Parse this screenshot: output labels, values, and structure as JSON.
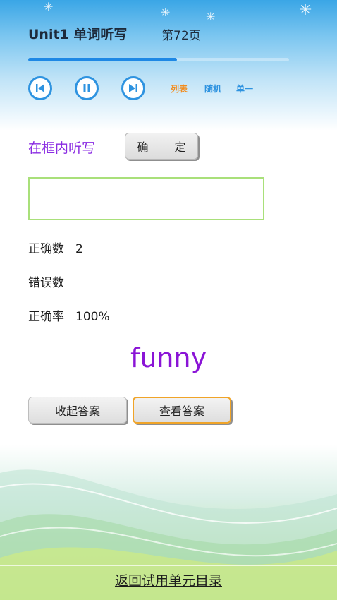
{
  "header": {
    "title": "Unit1 单词听写",
    "page": "第72页",
    "progress_fraction": 0.57
  },
  "controls": {
    "prev_icon": "skip-previous-icon",
    "pause_icon": "pause-icon",
    "next_icon": "skip-next-icon",
    "modes": [
      {
        "label": "列表",
        "color": "#f28c1e"
      },
      {
        "label": "随机",
        "color": "#2e93e0"
      },
      {
        "label": "单一",
        "color": "#2e93e0"
      }
    ]
  },
  "dictation": {
    "prompt": "在框内听写",
    "confirm_label": "确 定",
    "input_value": "",
    "input_placeholder": ""
  },
  "stats": {
    "correct_label": "正确数",
    "correct_value": "2",
    "wrong_label": "错误数",
    "wrong_value": "",
    "rate_label": "正确率",
    "rate_value": "100%"
  },
  "answer": {
    "word": "funny",
    "hide_label": "收起答案",
    "show_label": "查看答案"
  },
  "footer": {
    "back_label": "返回试用单元目录"
  },
  "colors": {
    "accent_blue": "#2e93e0",
    "prompt_purple": "#8a2be2",
    "word_purple": "#8a14d6",
    "input_border": "#a9e07a",
    "active_border": "#f0a428"
  }
}
